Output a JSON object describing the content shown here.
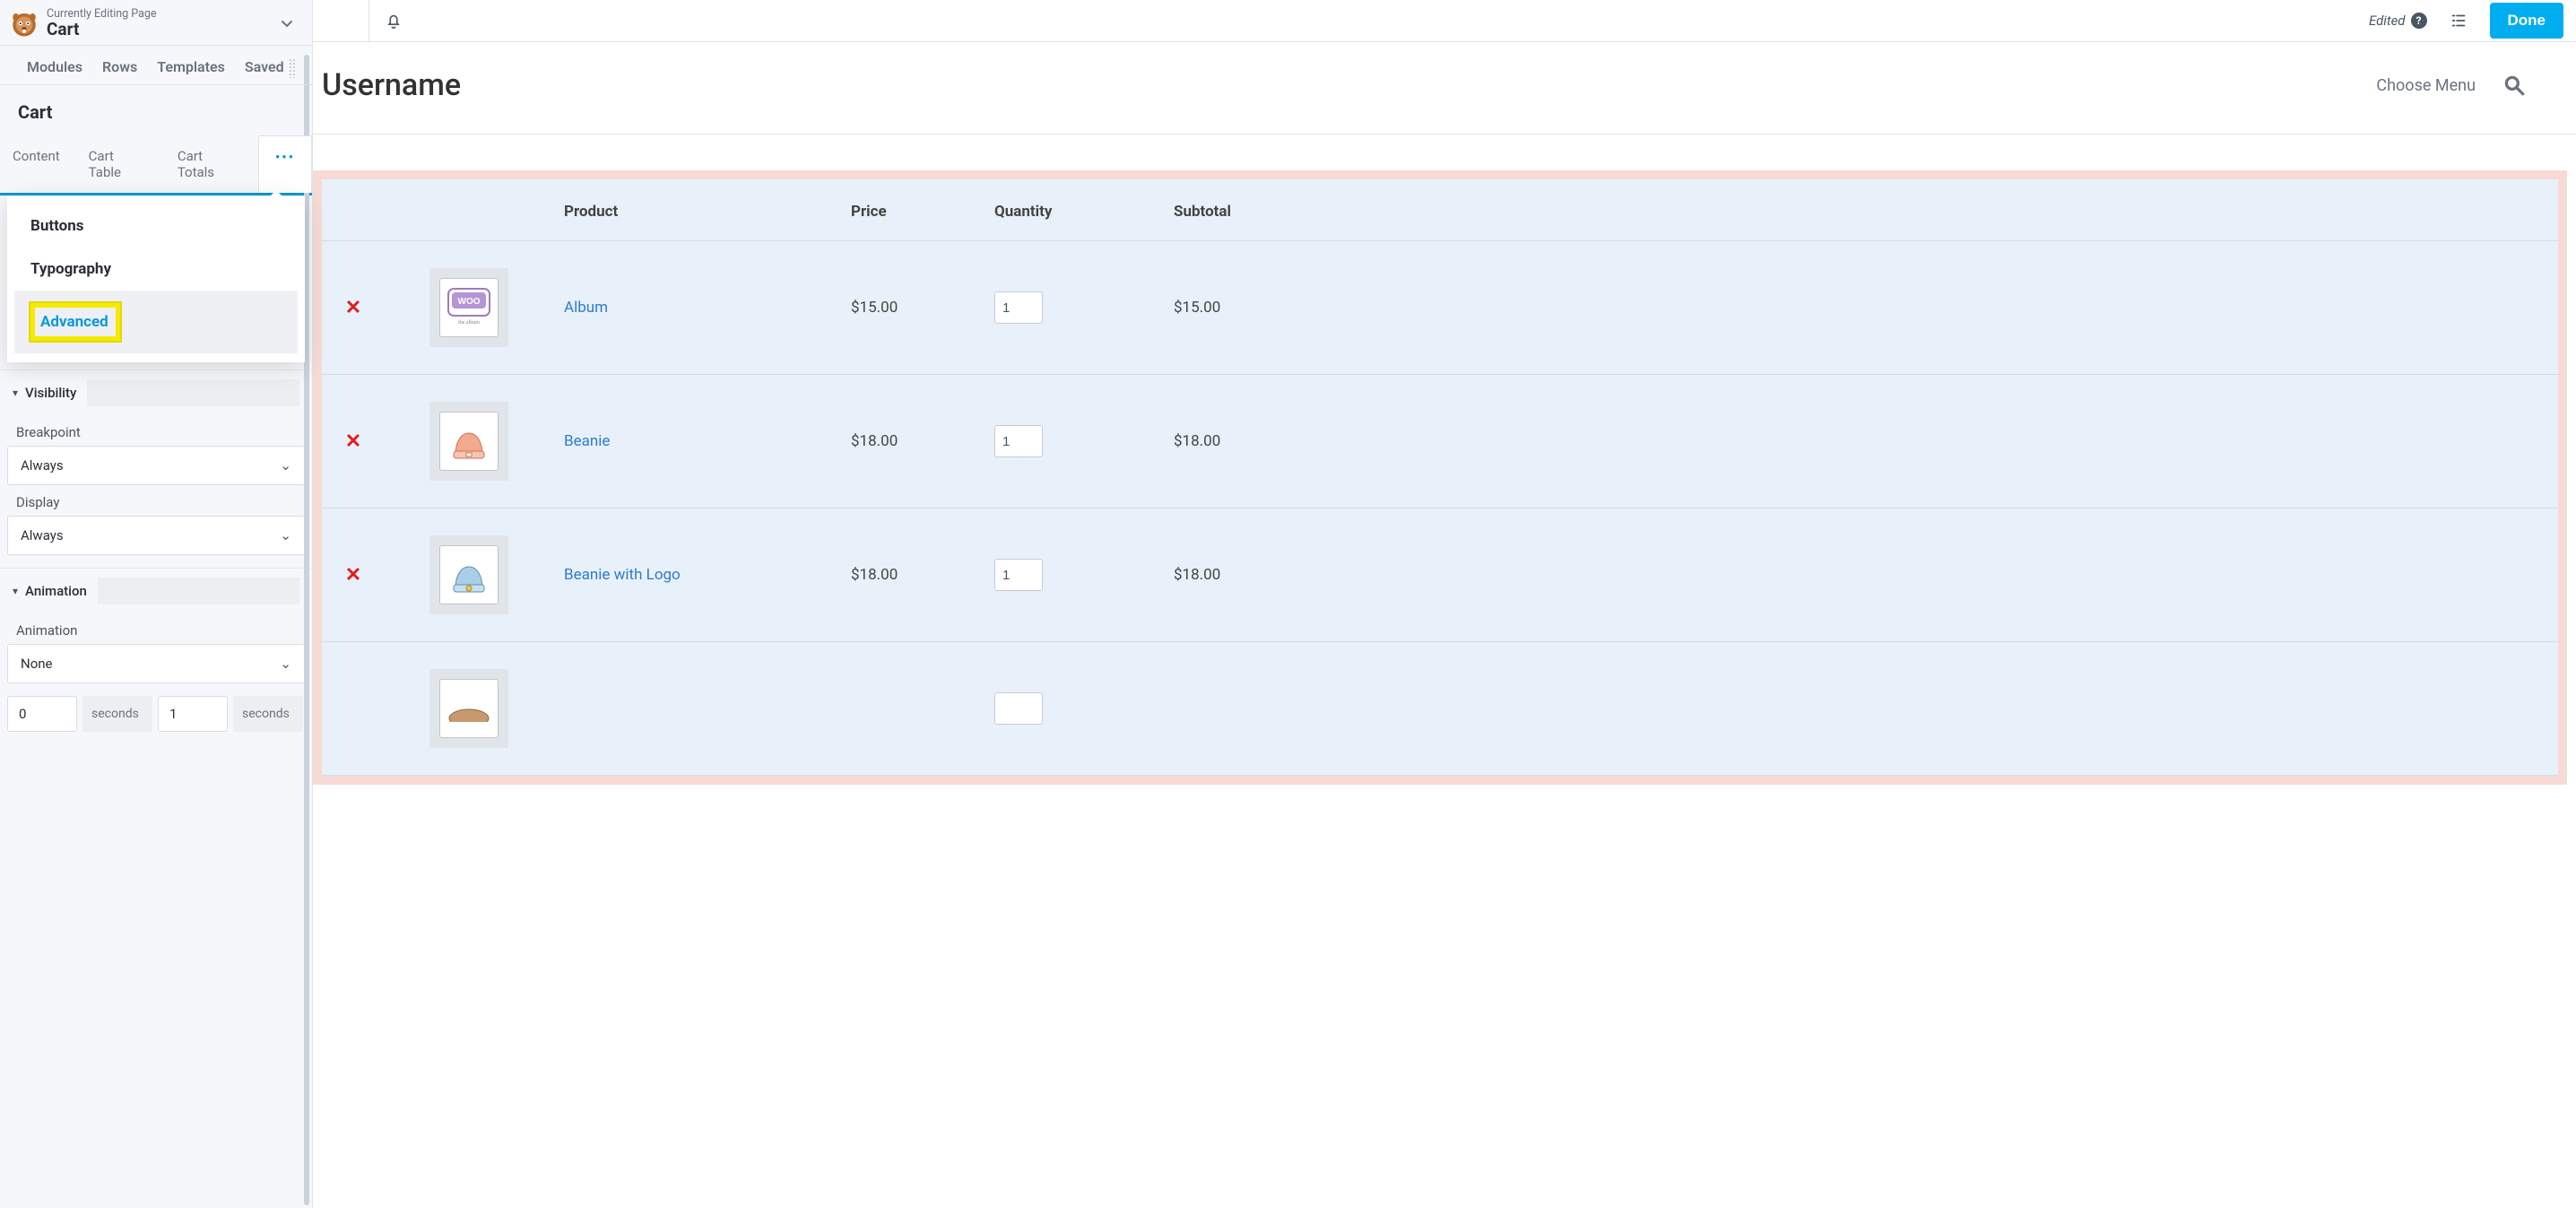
{
  "header": {
    "editing_label": "Currently Editing Page",
    "page_name": "Cart",
    "edited_label": "Edited",
    "done_label": "Done"
  },
  "sidebar_tabs": [
    "Modules",
    "Rows",
    "Templates",
    "Saved"
  ],
  "module": {
    "title": "Cart",
    "tabs": [
      "Content",
      "Cart Table",
      "Cart Totals"
    ],
    "more_glyph": "•••",
    "dropdown": [
      "Buttons",
      "Typography",
      "Advanced"
    ]
  },
  "sections": {
    "visibility": {
      "title": "Visibility",
      "breakpoint_label": "Breakpoint",
      "breakpoint_value": "Always",
      "display_label": "Display",
      "display_value": "Always"
    },
    "animation": {
      "title": "Animation",
      "animation_label": "Animation",
      "animation_value": "None",
      "delay_value": "0",
      "delay_unit": "seconds",
      "duration_value": "1",
      "duration_unit": "seconds"
    }
  },
  "page": {
    "username_heading": "Username",
    "choose_menu": "Choose Menu"
  },
  "cart": {
    "columns": {
      "product": "Product",
      "price": "Price",
      "quantity": "Quantity",
      "subtotal": "Subtotal"
    },
    "rows": [
      {
        "name": "Album",
        "price": "$15.00",
        "qty": "1",
        "subtotal": "$15.00",
        "thumb": "woo"
      },
      {
        "name": "Beanie",
        "price": "$18.00",
        "qty": "1",
        "subtotal": "$18.00",
        "thumb": "beanie1"
      },
      {
        "name": "Beanie with Logo",
        "price": "$18.00",
        "qty": "1",
        "subtotal": "$18.00",
        "thumb": "beanie2"
      }
    ]
  }
}
